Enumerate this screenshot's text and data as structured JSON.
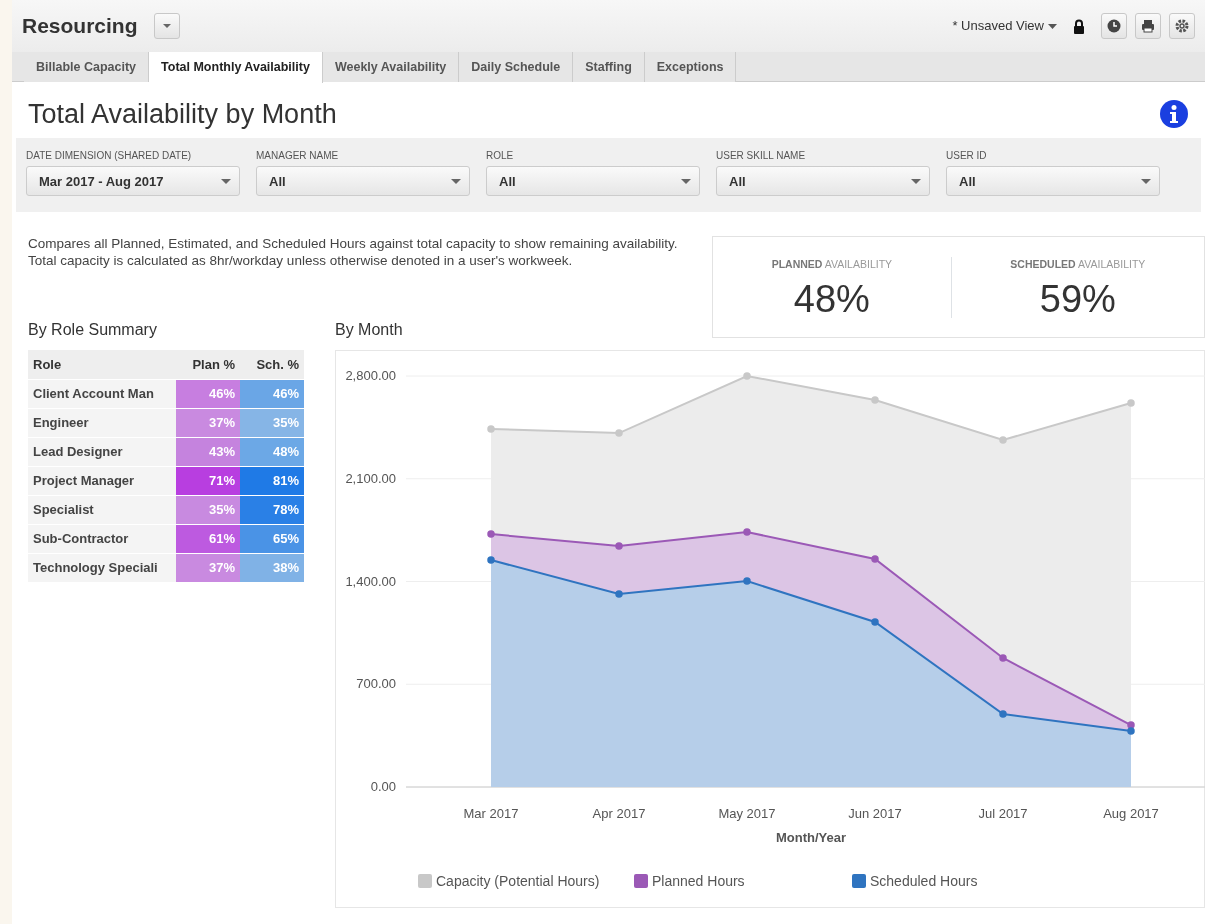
{
  "header": {
    "title": "Resourcing",
    "view": "* Unsaved View"
  },
  "tabs": [
    {
      "label": "Billable Capacity",
      "selected": false
    },
    {
      "label": "Total Monthly Availability",
      "selected": true
    },
    {
      "label": "Weekly Availability",
      "selected": false
    },
    {
      "label": "Daily Schedule",
      "selected": false
    },
    {
      "label": "Staffing",
      "selected": false
    },
    {
      "label": "Exceptions",
      "selected": false
    }
  ],
  "page_title": "Total Availability by Month",
  "filters": [
    {
      "label": "DATE DIMENSION (SHARED DATE)",
      "value": "Mar 2017 - Aug 2017"
    },
    {
      "label": "MANAGER NAME",
      "value": "All"
    },
    {
      "label": "ROLE",
      "value": "All"
    },
    {
      "label": "USER SKILL NAME",
      "value": "All"
    },
    {
      "label": "USER ID",
      "value": "All"
    }
  ],
  "description": "Compares all Planned, Estimated, and Scheduled Hours against total capacity to show remaining availability. Total capacity is calculated as 8hr/workday unless otherwise denoted in a user's workweek.",
  "kpis": [
    {
      "label": "**PLANNED** AVAILABILITY",
      "value": "48%"
    },
    {
      "label": "**SCHEDULED** AVAILABILITY",
      "value": "59%"
    }
  ],
  "role_summary": {
    "title": "By Role Summary",
    "columns": [
      "Role",
      "Plan %",
      "Sch. %"
    ],
    "rows": [
      {
        "role": "Client Account Man",
        "plan": {
          "text": "46%",
          "color": "#c77ee0"
        },
        "sch": {
          "text": "46%",
          "color": "#6aa6e6"
        }
      },
      {
        "role": "Engineer",
        "plan": {
          "text": "37%",
          "color": "#c98ae0"
        },
        "sch": {
          "text": "35%",
          "color": "#86b5e6"
        }
      },
      {
        "role": "Lead Designer",
        "plan": {
          "text": "43%",
          "color": "#c583de"
        },
        "sch": {
          "text": "48%",
          "color": "#6ca8e6"
        }
      },
      {
        "role": "Project Manager",
        "plan": {
          "text": "71%",
          "color": "#b83ee0"
        },
        "sch": {
          "text": "81%",
          "color": "#1f7ae6"
        }
      },
      {
        "role": "Specialist",
        "plan": {
          "text": "35%",
          "color": "#c88ae0"
        },
        "sch": {
          "text": "78%",
          "color": "#2a80e6"
        }
      },
      {
        "role": "Sub-Contractor",
        "plan": {
          "text": "61%",
          "color": "#bd5ae0"
        },
        "sch": {
          "text": "65%",
          "color": "#4a93e6"
        }
      },
      {
        "role": "Technology Speciali",
        "plan": {
          "text": "37%",
          "color": "#c98ae0"
        },
        "sch": {
          "text": "38%",
          "color": "#80b2e6"
        }
      }
    ]
  },
  "by_month": {
    "title": "By Month",
    "chart_data": {
      "type": "area",
      "xlabel": "Month/Year",
      "categories": [
        "Mar 2017",
        "Apr 2017",
        "May 2017",
        "Jun 2017",
        "Jul 2017",
        "Aug 2017"
      ],
      "ylim": [
        0,
        2800
      ],
      "yticks": [
        {
          "value": 0,
          "label": "0.00"
        },
        {
          "value": 700,
          "label": "700.00"
        },
        {
          "value": 1400,
          "label": "1,400.00"
        },
        {
          "value": 2100,
          "label": "2,100.00"
        },
        {
          "value": 2800,
          "label": "2,800.00"
        }
      ],
      "stacked": false,
      "grid": true,
      "legend": true,
      "series": [
        {
          "name": "Capacity (Potential Hours)",
          "color": "#c8c8c8",
          "values": [
            2439,
            2411,
            2800,
            2636,
            2364,
            2616
          ]
        },
        {
          "name": "Planned Hours",
          "color": "#9b59b6",
          "values": [
            1723,
            1642,
            1737,
            1553,
            879,
            422
          ]
        },
        {
          "name": "Scheduled Hours",
          "color": "#2f74c0",
          "values": [
            1546,
            1315,
            1403,
            1124,
            497,
            381
          ]
        }
      ]
    }
  }
}
